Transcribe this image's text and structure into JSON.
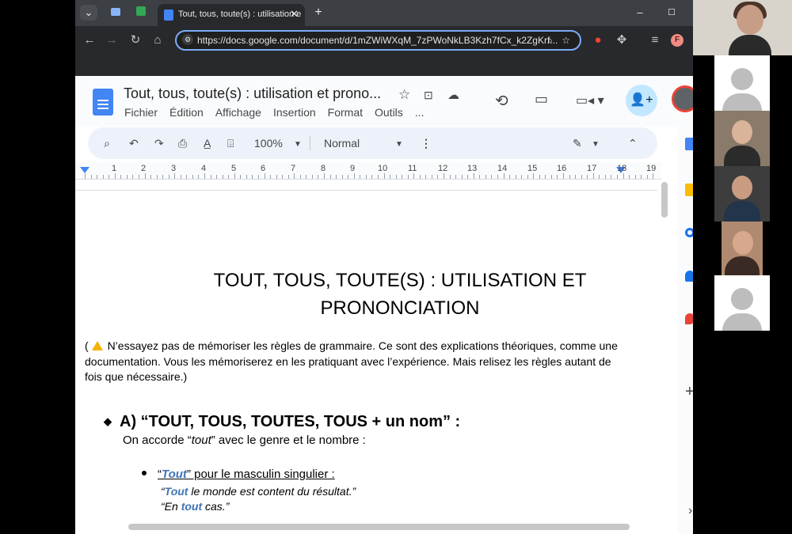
{
  "browser": {
    "tab_title": "Tout, tous, toute(s) : utilisation e",
    "url": "https://docs.google.com/document/d/1mZWiWXqM_7zPWoNkLB3Kzh7fCx_k2ZgKrf...",
    "profile_initial": "F"
  },
  "docs": {
    "title": "Tout, tous, toute(s) : utilisation et prono...",
    "menus": [
      "Fichier",
      "Édition",
      "Affichage",
      "Insertion",
      "Format",
      "Outils",
      "..."
    ],
    "zoom": "100%",
    "style": "Normal",
    "ruler": [
      "1",
      "2",
      "3",
      "4",
      "5",
      "6",
      "7",
      "8",
      "9",
      "10",
      "11",
      "12",
      "13",
      "14",
      "15",
      "16",
      "17",
      "18",
      "19"
    ]
  },
  "content": {
    "title_line1": "TOUT, TOUS, TOUTE(S) : UTILISATION  ET",
    "title_line2": "PRONONCIATION",
    "note_open": "(",
    "note_text": "N’essayez pas de mémoriser les règles de grammaire. Ce sont des explications théoriques, comme une documentation. Vous les mémoriserez en les pratiquant avec l’expérience. Mais relisez les règles autant de fois que nécessaire.)",
    "heading_a": "A) “TOUT, TOUS, TOUTES, TOUS + un nom” :",
    "accord_pre": "On accorde “",
    "accord_kw": "tout",
    "accord_post": "” avec le genre et le nombre :",
    "bullet1_q1": "“",
    "bullet1_kw": "Tout",
    "bullet1_rest": "” pour le masculin singulier :",
    "ex1_q": "“",
    "ex1_kw": "Tout",
    "ex1_rest": " le monde est content du résultat.”",
    "ex2_pre": "“En ",
    "ex2_kw": "tout",
    "ex2_rest": " cas.”"
  },
  "colors": {
    "accent": "#3f74b5",
    "browser_dark": "#28292c",
    "docs_bg": "#f9fbfd",
    "warning": "#f4b400"
  }
}
